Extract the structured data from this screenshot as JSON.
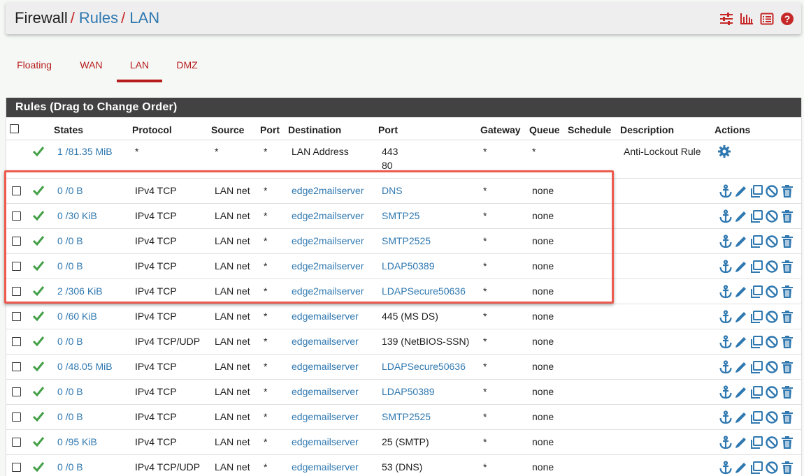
{
  "breadcrumb": {
    "first": "Firewall",
    "second": "Rules",
    "third": "LAN",
    "sep": "/"
  },
  "header_icons": [
    "settings-sliders-icon",
    "bar-chart-icon",
    "list-log-icon",
    "help-icon"
  ],
  "tabs": [
    {
      "label": "Floating"
    },
    {
      "label": "WAN"
    },
    {
      "label": "LAN",
      "active": true
    },
    {
      "label": "DMZ"
    }
  ],
  "panel_title": "Rules (Drag to Change Order)",
  "columns": {
    "states": "States",
    "protocol": "Protocol",
    "source": "Source",
    "port": "Port",
    "destination": "Destination",
    "dport": "Port",
    "gateway": "Gateway",
    "queue": "Queue",
    "schedule": "Schedule",
    "description": "Description",
    "actions": "Actions"
  },
  "anti_lockout": {
    "states": "1 /81.35 MiB",
    "protocol": "*",
    "source": "*",
    "port": "*",
    "destination": "LAN Address",
    "dport_1": "443",
    "dport_2": "80",
    "gateway": "*",
    "queue": "*",
    "description": "Anti-Lockout Rule"
  },
  "rules": [
    {
      "states": "0 /0 B",
      "protocol": "IPv4 TCP",
      "source": "LAN net",
      "port": "*",
      "destination": "edge2mailserver",
      "dport": "DNS",
      "dport_link": true,
      "gateway": "*",
      "queue": "none"
    },
    {
      "states": "0 /30 KiB",
      "protocol": "IPv4 TCP",
      "source": "LAN net",
      "port": "*",
      "destination": "edge2mailserver",
      "dport": "SMTP25",
      "dport_link": true,
      "gateway": "*",
      "queue": "none"
    },
    {
      "states": "0 /0 B",
      "protocol": "IPv4 TCP",
      "source": "LAN net",
      "port": "*",
      "destination": "edge2mailserver",
      "dport": "SMTP2525",
      "dport_link": true,
      "gateway": "*",
      "queue": "none"
    },
    {
      "states": "0 /0 B",
      "protocol": "IPv4 TCP",
      "source": "LAN net",
      "port": "*",
      "destination": "edge2mailserver",
      "dport": "LDAP50389",
      "dport_link": true,
      "gateway": "*",
      "queue": "none"
    },
    {
      "states": "2 /306 KiB",
      "protocol": "IPv4 TCP",
      "source": "LAN net",
      "port": "*",
      "destination": "edge2mailserver",
      "dport": "LDAPSecure50636",
      "dport_link": true,
      "gateway": "*",
      "queue": "none"
    },
    {
      "states": "0 /60 KiB",
      "protocol": "IPv4 TCP",
      "source": "LAN net",
      "port": "*",
      "destination": "edgemailserver",
      "dport": "445 (MS DS)",
      "dport_link": false,
      "gateway": "*",
      "queue": "none"
    },
    {
      "states": "0 /0 B",
      "protocol": "IPv4 TCP/UDP",
      "source": "LAN net",
      "port": "*",
      "destination": "edgemailserver",
      "dport": "139 (NetBIOS-SSN)",
      "dport_link": false,
      "gateway": "*",
      "queue": "none"
    },
    {
      "states": "0 /48.05 MiB",
      "protocol": "IPv4 TCP",
      "source": "LAN net",
      "port": "*",
      "destination": "edgemailserver",
      "dport": "LDAPSecure50636",
      "dport_link": true,
      "gateway": "*",
      "queue": "none"
    },
    {
      "states": "0 /0 B",
      "protocol": "IPv4 TCP",
      "source": "LAN net",
      "port": "*",
      "destination": "edgemailserver",
      "dport": "LDAP50389",
      "dport_link": true,
      "gateway": "*",
      "queue": "none"
    },
    {
      "states": "0 /0 B",
      "protocol": "IPv4 TCP",
      "source": "LAN net",
      "port": "*",
      "destination": "edgemailserver",
      "dport": "SMTP2525",
      "dport_link": true,
      "gateway": "*",
      "queue": "none"
    },
    {
      "states": "0 /95 KiB",
      "protocol": "IPv4 TCP",
      "source": "LAN net",
      "port": "*",
      "destination": "edgemailserver",
      "dport": "25 (SMTP)",
      "dport_link": false,
      "gateway": "*",
      "queue": "none"
    },
    {
      "states": "0 /0 B",
      "protocol": "IPv4 TCP/UDP",
      "source": "LAN net",
      "port": "*",
      "destination": "edgemailserver",
      "dport": "53 (DNS)",
      "dport_link": false,
      "gateway": "*",
      "queue": "none"
    }
  ],
  "row_action_icons": [
    "anchor-icon",
    "pencil-icon",
    "copy-icon",
    "disable-icon",
    "trash-icon"
  ],
  "colors": {
    "accent_red": "#b71c1c",
    "link_blue": "#2f78b0",
    "check_green": "#43a047",
    "title_bar": "#424242",
    "highlight": "#ec5b4d"
  }
}
